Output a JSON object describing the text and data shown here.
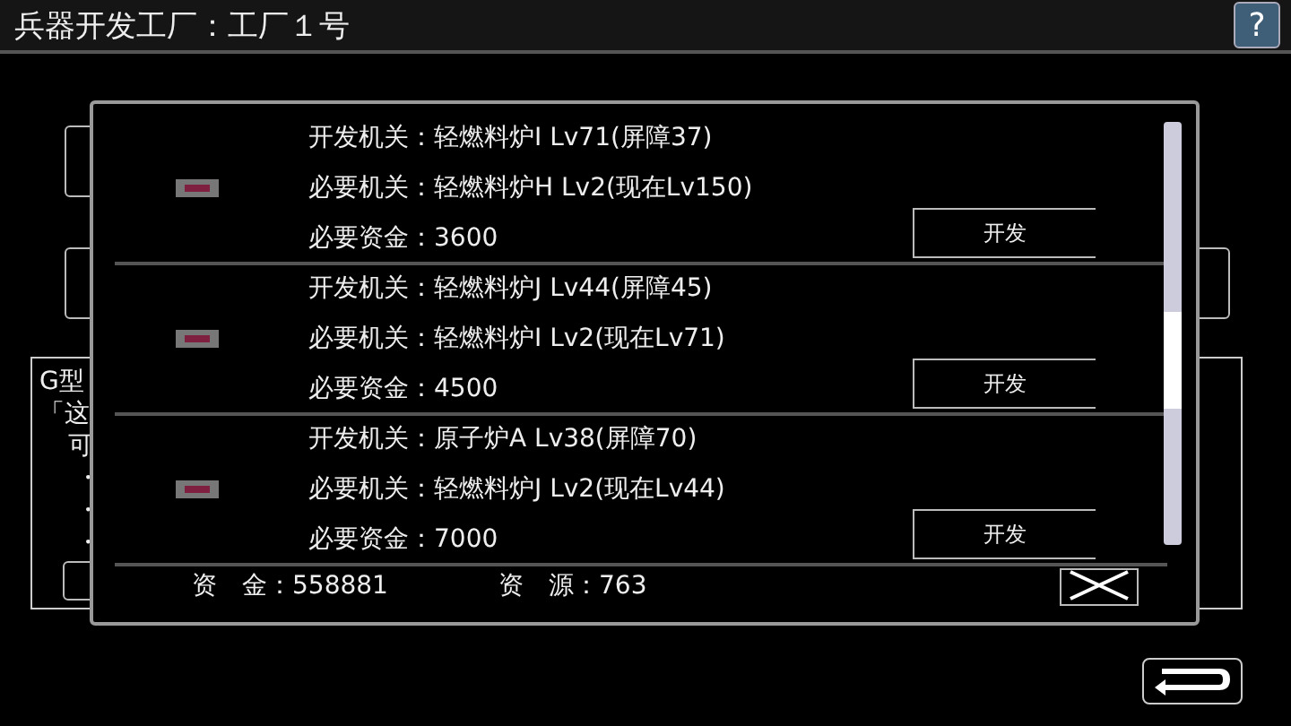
{
  "title": "兵器开发工厂：工厂１号",
  "help_button": "?",
  "background": {
    "panel_lines": [
      "G型",
      "「这",
      "可",
      "・",
      "・",
      "・"
    ]
  },
  "dialog": {
    "items": [
      {
        "develop": "开发机关：轻燃料炉I Lv71(屏障37)",
        "required": "必要机关：轻燃料炉H Lv2(现在Lv150)",
        "cost": "必要资金：3600",
        "button": "开发"
      },
      {
        "develop": "开发机关：轻燃料炉J Lv44(屏障45)",
        "required": "必要机关：轻燃料炉I Lv2(现在Lv71)",
        "cost": "必要资金：4500",
        "button": "开发"
      },
      {
        "develop": "开发机关：原子炉A Lv38(屏障70)",
        "required": "必要机关：轻燃料炉J Lv2(现在Lv44)",
        "cost": "必要资金：7000",
        "button": "开发"
      }
    ],
    "funds": "资　金：558881",
    "resources": "资　源：763"
  }
}
